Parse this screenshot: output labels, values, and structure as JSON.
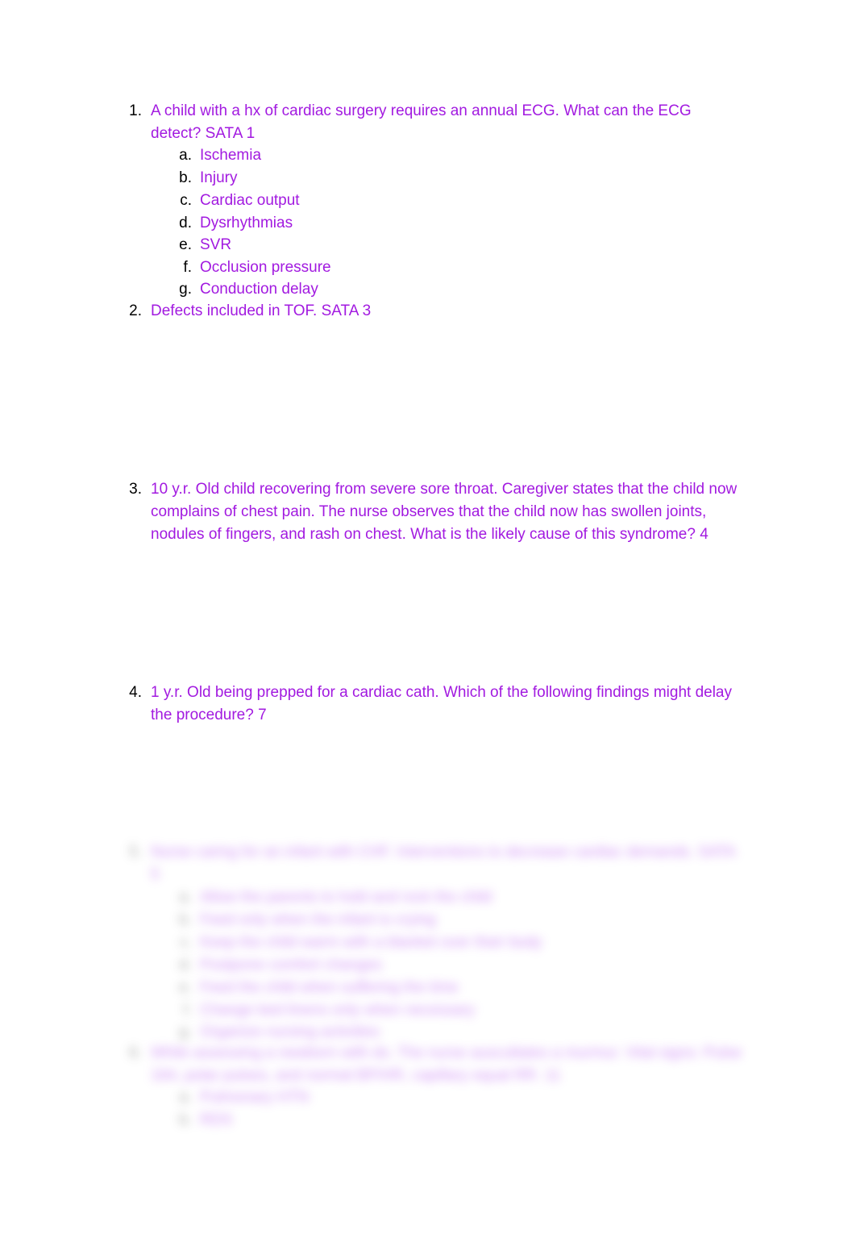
{
  "document": {
    "text_color": "#a21ae0",
    "marker_color": "#000000",
    "background_color": "#ffffff",
    "blurred_text_color": "#b44ef0"
  },
  "questions": [
    {
      "marker": "1.",
      "text": "A child with a hx of cardiac surgery requires an annual ECG. What can the ECG detect? SATA 1",
      "blurred": false,
      "options": [
        {
          "marker": "a.",
          "text": "Ischemia"
        },
        {
          "marker": "b.",
          "text": "Injury"
        },
        {
          "marker": "c.",
          "text": "Cardiac output"
        },
        {
          "marker": "d.",
          "text": "Dysrhythmias"
        },
        {
          "marker": "e.",
          "text": "SVR"
        },
        {
          "marker": "f.",
          "text": "Occlusion pressure"
        },
        {
          "marker": "g.",
          "text": "Conduction delay"
        }
      ]
    },
    {
      "marker": "2.",
      "text": "Defects included in TOF. SATA 3",
      "blurred": false,
      "options": []
    },
    {
      "marker": "3.",
      "text": "10 y.r. Old child recovering from severe sore throat. Caregiver states that the child now complains of chest pain. The nurse observes that the child now has swollen joints, nodules of fingers, and rash on chest. What is the likely cause of this syndrome? 4",
      "blurred": false,
      "options": []
    },
    {
      "marker": "4.",
      "text": "1 y.r. Old being prepped for a cardiac cath. Which of the following findings might delay the procedure? 7",
      "blurred": false,
      "options": []
    },
    {
      "marker": "5.",
      "text": "Nurse caring for an infant with CHF. Interventions to decrease cardiac demands. SATA 5",
      "blurred": true,
      "options": [
        {
          "marker": "a.",
          "text": "Allow the parents to hold and rock the child"
        },
        {
          "marker": "b.",
          "text": "Feed only when the infant is crying"
        },
        {
          "marker": "c.",
          "text": "Keep the child warm with a blanket over their body"
        },
        {
          "marker": "d.",
          "text": "Postpone comfort changes"
        },
        {
          "marker": "e.",
          "text": "Feed the child when suffering the time"
        },
        {
          "marker": "f.",
          "text": "Change bed linens only when necessary"
        },
        {
          "marker": "g.",
          "text": "Organize nursing activities"
        }
      ]
    },
    {
      "marker": "6.",
      "text": "While assessing a newborn with ds. The nurse auscultates a murmur. Vital signs: Pulse 164, polar pulses, and normal BP/HR, capillary equal RR. 11",
      "blurred": true,
      "options": [
        {
          "marker": "a.",
          "text": "Pulmonary HTN"
        },
        {
          "marker": "b.",
          "text": "RDS"
        }
      ]
    }
  ]
}
